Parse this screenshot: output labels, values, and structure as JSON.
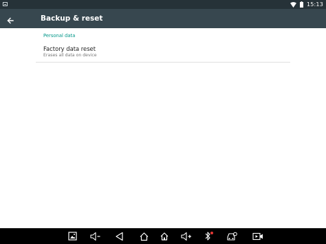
{
  "status_bar": {
    "time": "15:13",
    "icons": [
      "screenshot-notification-icon",
      "wifi-icon",
      "battery-icon"
    ]
  },
  "toolbar": {
    "title": "Backup & reset",
    "back_icon": "arrow-back-icon"
  },
  "settings": {
    "section_header": "Personal data",
    "items": [
      {
        "title": "Factory data reset",
        "summary": "Erases all data on device"
      }
    ]
  },
  "nav_bar": {
    "buttons": [
      "screenshot-icon",
      "volume-down-icon",
      "back-icon",
      "home-icon",
      "volume-up-icon",
      "bluetooth-icon",
      "car-mode-icon",
      "video-icon"
    ]
  },
  "colors": {
    "status_bar": "#263238",
    "toolbar": "#37474f",
    "accent": "#009688",
    "nav_bar": "#000000",
    "bluetooth_badge": "#e53935"
  }
}
